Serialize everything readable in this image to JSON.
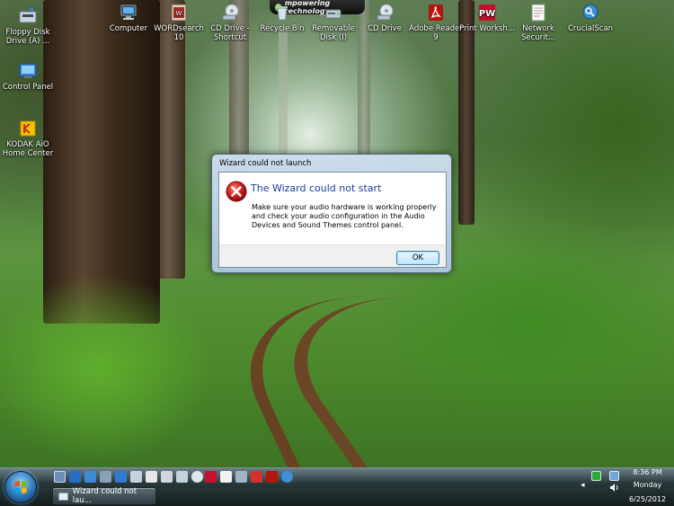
{
  "brand_badge": "mpowering technology",
  "desktop_icons": [
    {
      "label": "Floppy Disk Drive (A) ...",
      "icon": "floppy-drive-icon"
    },
    {
      "label": "Control Panel",
      "icon": "control-panel-icon"
    },
    {
      "label": "KODAK AiO Home Center",
      "icon": "kodak-icon"
    },
    {
      "label": "Computer",
      "icon": "computer-icon"
    },
    {
      "label": "WORDsearch 10",
      "icon": "wordsearch-icon"
    },
    {
      "label": "CD Drive - Shortcut",
      "icon": "cd-drive-icon"
    },
    {
      "label": "Recycle Bin",
      "icon": "recycle-bin-icon"
    },
    {
      "label": "Removable Disk (I)",
      "icon": "removable-disk-icon"
    },
    {
      "label": "CD Drive",
      "icon": "cd-drive-icon"
    },
    {
      "label": "Adobe Reader 9",
      "icon": "adobe-reader-icon"
    },
    {
      "label": "Print Worksh...",
      "icon": "print-workshop-icon"
    },
    {
      "label": "Network Securit...",
      "icon": "document-icon"
    },
    {
      "label": "CrucialScan",
      "icon": "crucialscan-icon"
    }
  ],
  "dialog": {
    "title": "Wizard could not launch",
    "heading": "The Wizard could not start",
    "message": "Make sure your audio hardware is working properly and check your audio configuration in the Audio Devices and Sound Themes control panel.",
    "ok_label": "OK",
    "icon": "error-icon"
  },
  "taskbar": {
    "task_button_label": "Wizard could not lau...",
    "clock_time": "8:36 PM",
    "clock_day": "Monday",
    "clock_date": "6/25/2012"
  },
  "colors": {
    "dialog_heading": "#1c3c9a",
    "error_red": "#d32020"
  }
}
